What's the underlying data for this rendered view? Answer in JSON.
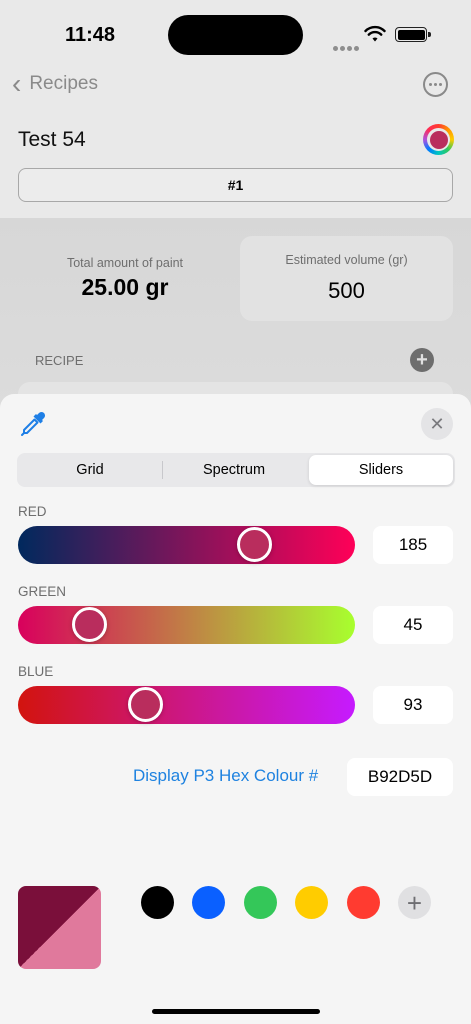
{
  "status_bar": {
    "time": "11:48"
  },
  "nav": {
    "back_label": "Recipes"
  },
  "recipe": {
    "title": "Test 54",
    "variant": "#1",
    "total_label": "Total amount of paint",
    "total_value": "25.00 gr",
    "volume_label": "Estimated volume (gr)",
    "volume_value": "500",
    "section_label": "RECIPE"
  },
  "picker": {
    "tabs": [
      "Grid",
      "Spectrum",
      "Sliders"
    ],
    "selected_tab": "Sliders",
    "channels": [
      {
        "label": "RED",
        "value": "185",
        "fraction": 0.7255
      },
      {
        "label": "GREEN",
        "value": "45",
        "fraction": 0.1765
      },
      {
        "label": "BLUE",
        "value": "93",
        "fraction": 0.3647
      }
    ],
    "hex_label": "Display P3 Hex Colour #",
    "hex_value": "B92D5D",
    "current_color": "#B92D5D",
    "original_color": "#7a0f3a",
    "new_color": "#e0799c",
    "swatches": [
      "#000000",
      "#0a60ff",
      "#34c759",
      "#ffcc00",
      "#ff3b30"
    ]
  },
  "icons": {
    "back": "chevron-left-icon",
    "more": "ellipsis-circle-icon",
    "picker": "color-ring-icon",
    "eyedropper": "eyedropper-icon",
    "close": "close-icon",
    "add": "plus-icon"
  }
}
